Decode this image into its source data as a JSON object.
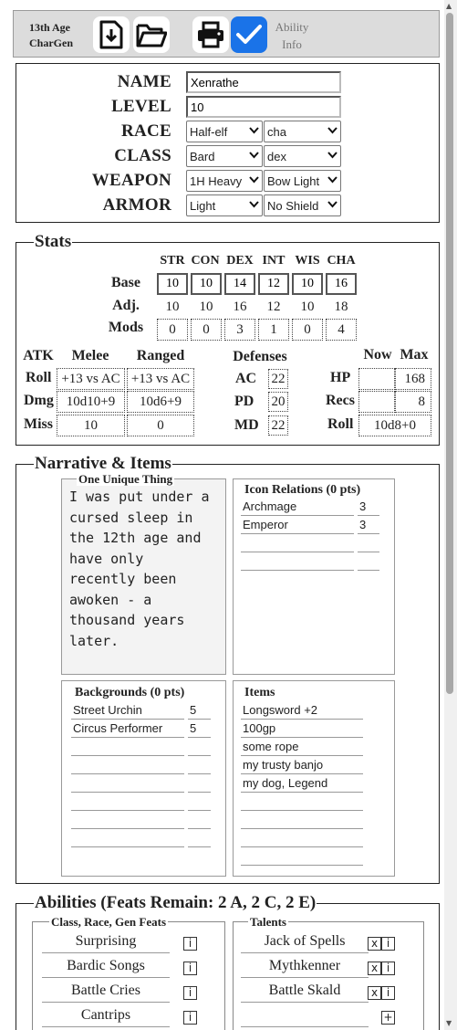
{
  "app": {
    "name": "13th Age\nCharGen"
  },
  "toolbar": {
    "buttons": [
      {
        "name": "download-button",
        "icon": "download-icon"
      },
      {
        "name": "open-folder-button",
        "icon": "folder-open-icon"
      },
      {
        "name": "print-button",
        "icon": "printer-icon"
      },
      {
        "name": "ability-info-toggle",
        "icon": "checkmark-icon",
        "checked": true
      }
    ],
    "ability_info_label": "Ability Info",
    "accent": "#1a73e8"
  },
  "character": {
    "name_label": "NAME",
    "name": "Xenrathe",
    "level_label": "LEVEL",
    "level": "10",
    "race_label": "RACE",
    "race": "Half-elf",
    "race_bonus": "cha",
    "class_label": "CLASS",
    "class": "Bard",
    "class_bonus": "dex",
    "weapon_label": "WEAPON",
    "weapon_melee": "1H Heavy",
    "weapon_ranged": "Bow Light",
    "armor_label": "ARMOR",
    "armor": "Light",
    "shield": "No Shield"
  },
  "stats": {
    "legend": "Stats",
    "headers": [
      "STR",
      "CON",
      "DEX",
      "INT",
      "WIS",
      "CHA"
    ],
    "base_label": "Base",
    "base": [
      "10",
      "10",
      "14",
      "12",
      "10",
      "16"
    ],
    "adj_label": "Adj.",
    "adj": [
      "10",
      "10",
      "16",
      "12",
      "10",
      "18"
    ],
    "mods_label": "Mods",
    "mods": [
      "0",
      "0",
      "3",
      "1",
      "0",
      "4"
    ],
    "attack": {
      "header": "ATK",
      "melee_header": "Melee",
      "ranged_header": "Ranged",
      "roll_label": "Roll",
      "roll_melee": "+13 vs AC",
      "roll_ranged": "+13 vs AC",
      "dmg_label": "Dmg",
      "dmg_melee": "10d10+9",
      "dmg_ranged": "10d6+9",
      "miss_label": "Miss",
      "miss_melee": "10",
      "miss_ranged": "0"
    },
    "defenses": {
      "header": "Defenses",
      "ac_label": "AC",
      "ac": "22",
      "pd_label": "PD",
      "pd": "20",
      "md_label": "MD",
      "md": "22"
    },
    "vitals": {
      "now_header": "Now",
      "max_header": "Max",
      "hp_label": "HP",
      "hp_now": "",
      "hp_max": "168",
      "recs_label": "Recs",
      "recs_now": "",
      "recs_max": "8",
      "roll_label": "Roll",
      "roll": "10d8+0"
    }
  },
  "narrative": {
    "legend": "Narrative & Items",
    "unique_legend": "One Unique Thing",
    "unique_text": "I was put under a cursed sleep in the 12th age and have only recently been awoken - a thousand years later.",
    "icons_header": "Icon Relations (0 pts)",
    "icons": [
      {
        "name": "Archmage",
        "pts": "3"
      },
      {
        "name": "Emperor",
        "pts": "3"
      },
      {
        "name": "",
        "pts": ""
      },
      {
        "name": "",
        "pts": ""
      }
    ],
    "backgrounds_header": "Backgrounds (0 pts)",
    "backgrounds": [
      {
        "name": "Street Urchin",
        "pts": "5"
      },
      {
        "name": "Circus Performer",
        "pts": "5"
      },
      {
        "name": "",
        "pts": ""
      },
      {
        "name": "",
        "pts": ""
      },
      {
        "name": "",
        "pts": ""
      },
      {
        "name": "",
        "pts": ""
      },
      {
        "name": "",
        "pts": ""
      },
      {
        "name": "",
        "pts": ""
      }
    ],
    "items_header": "Items",
    "items": [
      "Longsword +2",
      "100gp",
      "some rope",
      "my trusty banjo",
      "my dog, Legend",
      "",
      "",
      "",
      ""
    ]
  },
  "abilities": {
    "legend": "Abilities (Feats Remain: 2 A, 2 C, 2 E)",
    "feats_legend": "Class, Race, Gen Feats",
    "feats": [
      "Surprising",
      "Bardic Songs",
      "Battle Cries",
      "Cantrips"
    ],
    "talents_legend": "Talents",
    "talents": [
      "Jack of Spells",
      "Mythkenner",
      "Battle Skald",
      ""
    ],
    "info_glyph": "i",
    "remove_glyph": "x",
    "add_glyph": "+"
  }
}
